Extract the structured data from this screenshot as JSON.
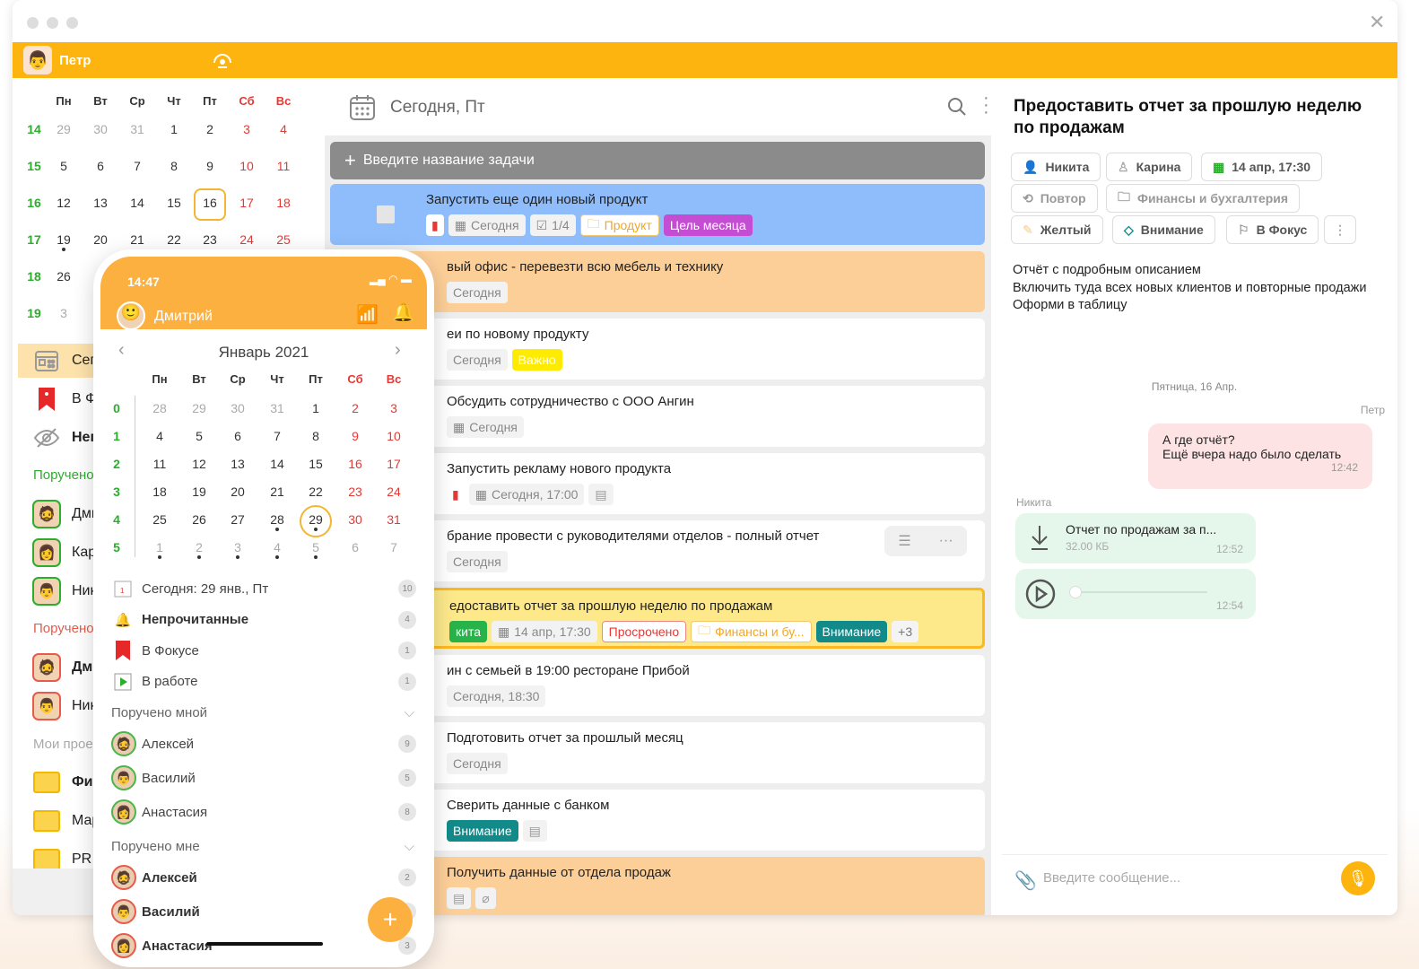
{
  "colors": {
    "accent": "#fdb40f",
    "phone_accent": "#fcb040",
    "weekend": "#e53935",
    "week_number": "#2bae2b"
  },
  "topbar": {
    "user": "Петр",
    "avatar_icon": "man-face-icon",
    "center_icon": "speedometer-icon"
  },
  "desktop_calendar": {
    "weekdays": [
      "Пн",
      "Вт",
      "Ср",
      "Чт",
      "Пт",
      "Сб",
      "Вс"
    ],
    "weeks": [
      {
        "n": "14",
        "days": [
          "29",
          "30",
          "31",
          "1",
          "2",
          "3",
          "4"
        ],
        "muted": [
          0,
          1,
          2
        ]
      },
      {
        "n": "15",
        "days": [
          "5",
          "6",
          "7",
          "8",
          "9",
          "10",
          "11"
        ],
        "muted": []
      },
      {
        "n": "16",
        "days": [
          "12",
          "13",
          "14",
          "15",
          "16",
          "17",
          "18"
        ],
        "muted": [],
        "today": 4
      },
      {
        "n": "17",
        "days": [
          "19",
          "20",
          "21",
          "22",
          "23",
          "24",
          "25"
        ],
        "muted": [],
        "dots": [
          0
        ]
      },
      {
        "n": "18",
        "days": [
          "26",
          "",
          "",
          "",
          "",
          "",
          ""
        ],
        "muted": []
      },
      {
        "n": "19",
        "days": [
          "3",
          "",
          "",
          "",
          "",
          "",
          ""
        ],
        "muted": [
          0
        ]
      }
    ]
  },
  "sidebar": {
    "items": [
      {
        "label": "Сегодня",
        "icon": "calendar-icon",
        "active": true
      },
      {
        "label": "В Фокусе",
        "icon": "bookmark-icon"
      },
      {
        "label": "Непрочитанные",
        "icon": "eye-off-icon",
        "bold": true
      }
    ],
    "section_by_me": "Поручено мной",
    "by_me": [
      {
        "label": "Дмитрий"
      },
      {
        "label": "Карина"
      },
      {
        "label": "Никита"
      }
    ],
    "section_to_me": "Поручено мне",
    "to_me": [
      {
        "label": "Дмитрий",
        "bold": true
      },
      {
        "label": "Никита"
      }
    ],
    "section_projects": "Мои проекты",
    "projects": [
      {
        "label": "Финансы",
        "bold": true
      },
      {
        "label": "Маркетинг"
      },
      {
        "label": "PR"
      }
    ]
  },
  "main": {
    "title": "Сегодня, Пт",
    "new_task_placeholder": "Введите название задачи",
    "tasks": [
      {
        "title": "Запустить еще один новый продукт",
        "bg": "#8fbdfb",
        "checkbox": true,
        "chips": [
          {
            "type": "flag",
            "text": ""
          },
          {
            "type": "date",
            "text": "Сегодня"
          },
          {
            "type": "check",
            "text": "1/4"
          },
          {
            "type": "proj",
            "text": "Продукт"
          },
          {
            "type": "purple",
            "text": "Цель месяца"
          }
        ]
      },
      {
        "title": "вый офис - перевезти всю мебель и технику",
        "bg": "#fdcf98",
        "chips": [
          {
            "type": "plain",
            "text": "Сегодня"
          }
        ]
      },
      {
        "title": "еи по новому продукту",
        "bg": "#ffffff",
        "chips": [
          {
            "type": "plain",
            "text": "Сегодня"
          },
          {
            "type": "yellow",
            "text": "Важно"
          }
        ]
      },
      {
        "title": "Обсудить сотрудничество с ООО Ангин",
        "bg": "#ffffff",
        "chips": [
          {
            "type": "date",
            "text": "Сегодня"
          }
        ]
      },
      {
        "title": "Запустить рекламу нового продукта",
        "bg": "#ffffff",
        "chips": [
          {
            "type": "flag",
            "text": ""
          },
          {
            "type": "date",
            "text": "Сегодня, 17:00"
          },
          {
            "type": "comment",
            "text": ""
          }
        ]
      },
      {
        "title": "брание провести с руководителями отделов - полный отчет",
        "bg": "#ffffff",
        "hover_actions": true,
        "chips": [
          {
            "type": "plain",
            "text": "Сегодня"
          }
        ]
      },
      {
        "title": "едоставить отчет за прошлую неделю по продажам",
        "bg": "#fde98a",
        "selected": true,
        "chips": [
          {
            "type": "green",
            "text": "кита"
          },
          {
            "type": "date",
            "text": "14 апр, 17:30"
          },
          {
            "type": "overdue",
            "text": "Просрочено"
          },
          {
            "type": "proj",
            "text": "Финансы и бу..."
          },
          {
            "type": "teal",
            "text": "Внимание"
          },
          {
            "type": "plus",
            "text": "+3"
          }
        ]
      },
      {
        "title": "ин с семьей в 19:00 ресторане Прибой",
        "bg": "#ffffff",
        "chips": [
          {
            "type": "plain",
            "text": "Сегодня, 18:30"
          }
        ]
      },
      {
        "title": "Подготовить отчет за прошлый месяц",
        "bg": "#ffffff",
        "chips": [
          {
            "type": "plain",
            "text": "Сегодня"
          }
        ]
      },
      {
        "title": "Сверить данные с банком",
        "bg": "#ffffff",
        "chips": [
          {
            "type": "teal",
            "text": "Внимание"
          },
          {
            "type": "note",
            "text": ""
          }
        ]
      },
      {
        "title": "Получить данные от отдела продаж",
        "bg": "#fdcf98",
        "chips": [
          {
            "type": "note",
            "text": ""
          },
          {
            "type": "clip",
            "text": ""
          }
        ]
      }
    ]
  },
  "detail": {
    "title": "Предоставить отчет за прошлую неделю по продажам",
    "chips": {
      "assignee": "Никита",
      "author": "Карина",
      "date": "14 апр, 17:30",
      "repeat": "Повтор",
      "project": "Финансы и бухгалтерия",
      "color": "Желтый",
      "tag": "Внимание",
      "focus": "В Фокус"
    },
    "description": [
      "Отчёт с подробным описанием",
      "Включить туда всех новых клиентов и повторные продажи",
      "Оформи в таблицу"
    ],
    "chat": {
      "date": "Пятница, 16 Апр.",
      "msg1": {
        "author": "Петр",
        "lines": [
          "А где отчёт?",
          "Ещё вчера надо было сделать"
        ],
        "time": "12:42"
      },
      "msg2_author": "Никита",
      "file": {
        "name": "Отчет по продажам за п...",
        "size": "32.00 КБ",
        "time": "12:52"
      },
      "voice": {
        "time": "12:54",
        "progress": 0
      }
    },
    "input_placeholder": "Введите сообщение..."
  },
  "phone": {
    "time": "14:47",
    "user": "Дмитрий",
    "month": "Январь 2021",
    "weekdays": [
      "Пн",
      "Вт",
      "Ср",
      "Чт",
      "Пт",
      "Сб",
      "Вс"
    ],
    "weeks": [
      {
        "n": "0",
        "days": [
          "28",
          "29",
          "30",
          "31",
          "1",
          "2",
          "3"
        ],
        "muted": [
          0,
          1,
          2,
          3
        ]
      },
      {
        "n": "1",
        "days": [
          "4",
          "5",
          "6",
          "7",
          "8",
          "9",
          "10"
        ],
        "muted": []
      },
      {
        "n": "2",
        "days": [
          "11",
          "12",
          "13",
          "14",
          "15",
          "16",
          "17"
        ],
        "muted": []
      },
      {
        "n": "3",
        "days": [
          "18",
          "19",
          "20",
          "21",
          "22",
          "23",
          "24"
        ],
        "muted": []
      },
      {
        "n": "4",
        "days": [
          "25",
          "26",
          "27",
          "28",
          "29",
          "30",
          "31"
        ],
        "muted": [],
        "today": 4,
        "dots": [
          3,
          4
        ]
      },
      {
        "n": "5",
        "days": [
          "1",
          "2",
          "3",
          "4",
          "5",
          "6",
          "7"
        ],
        "muted": [
          0,
          1,
          2,
          3,
          4,
          5,
          6
        ],
        "dots": [
          0,
          1,
          2,
          3,
          4
        ]
      }
    ],
    "items": [
      {
        "label": "Сегодня: 29 янв., Пт",
        "icon": "calendar-icon",
        "count": "10"
      },
      {
        "label": "Непрочитанные",
        "icon": "bell-icon",
        "count": "4",
        "bold": true
      },
      {
        "label": "В Фокусе",
        "icon": "bookmark-icon",
        "count": "1"
      },
      {
        "label": "В работе",
        "icon": "play-icon",
        "count": "1"
      }
    ],
    "section_by_me": "Поручено мной",
    "by_me": [
      {
        "label": "Алексей",
        "count": "9"
      },
      {
        "label": "Василий",
        "count": "5"
      },
      {
        "label": "Анастасия",
        "count": "8"
      }
    ],
    "section_to_me": "Поручено мне",
    "to_me": [
      {
        "label": "Алексей",
        "count": "2"
      },
      {
        "label": "Василий",
        "count": "2"
      },
      {
        "label": "Анастасия",
        "count": "3"
      }
    ]
  }
}
